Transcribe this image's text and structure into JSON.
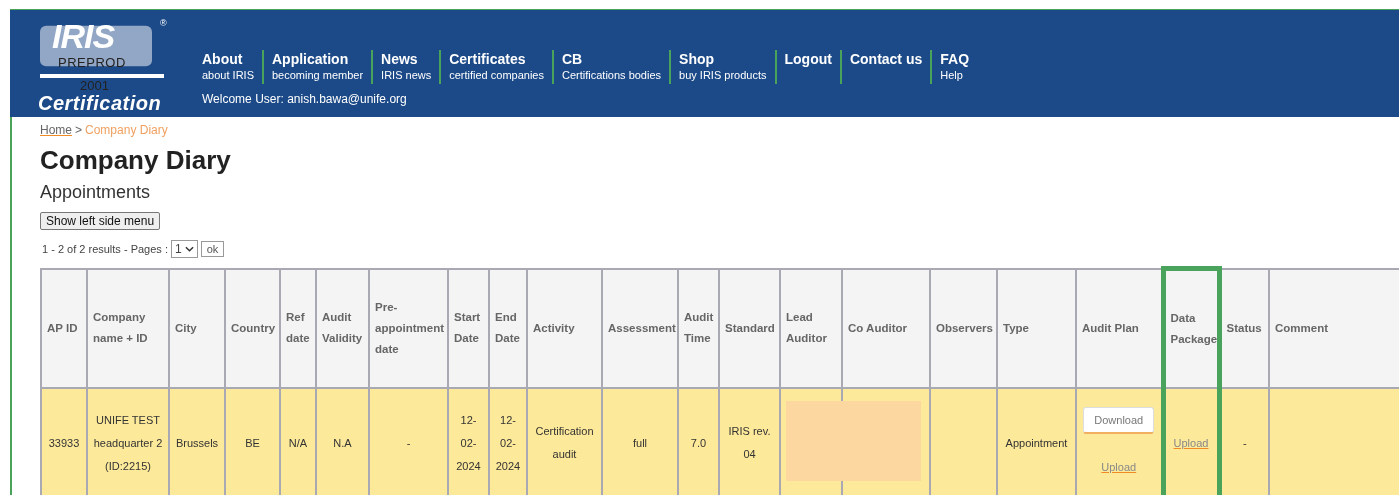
{
  "logo": {
    "wordmark": "IRIS",
    "registered": "®",
    "env_label": "PREPROD",
    "year": "2001",
    "tagline": "Certification"
  },
  "nav": [
    {
      "title": "About",
      "subtitle": "about IRIS"
    },
    {
      "title": "Application",
      "subtitle": "becoming member"
    },
    {
      "title": "News",
      "subtitle": "IRIS news"
    },
    {
      "title": "Certificates",
      "subtitle": "certified companies"
    },
    {
      "title": "CB",
      "subtitle": "Certifications bodies"
    },
    {
      "title": "Shop",
      "subtitle": "buy IRIS products"
    },
    {
      "title": "Logout"
    },
    {
      "title": "Contact us"
    },
    {
      "title": "FAQ",
      "subtitle": "Help"
    }
  ],
  "welcome": "Welcome User: anish.bawa@unife.org",
  "breadcrumb": {
    "home": "Home",
    "separator": ">",
    "current": "Company Diary"
  },
  "title": "Company Diary",
  "subtitle": "Appointments",
  "side_menu_button": "Show left side menu",
  "pagination": {
    "summary": "1 - 2 of 2 results - Pages :",
    "page": "1",
    "ok": "ok"
  },
  "table": {
    "columns": [
      {
        "label": "AP ID",
        "highlighted": false
      },
      {
        "label": "Company name + ID",
        "highlighted": false
      },
      {
        "label": "City",
        "highlighted": false
      },
      {
        "label": "Country",
        "highlighted": false
      },
      {
        "label": "Ref date",
        "highlighted": false
      },
      {
        "label": "Audit Validity",
        "highlighted": false
      },
      {
        "label": "Pre-appointment date",
        "highlighted": false
      },
      {
        "label": "Start Date",
        "highlighted": false
      },
      {
        "label": "End Date",
        "highlighted": false
      },
      {
        "label": "Activity",
        "highlighted": false
      },
      {
        "label": "Assessment",
        "highlighted": false
      },
      {
        "label": "Audit Time",
        "highlighted": false
      },
      {
        "label": "Standard",
        "highlighted": false
      },
      {
        "label": "Lead Auditor",
        "highlighted": false
      },
      {
        "label": "Co Auditor",
        "highlighted": false
      },
      {
        "label": "Observers",
        "highlighted": false
      },
      {
        "label": "Type",
        "highlighted": false
      },
      {
        "label": "Audit Plan",
        "highlighted": false
      },
      {
        "label": "Data Package",
        "highlighted": true
      },
      {
        "label": "Status",
        "highlighted": false
      },
      {
        "label": "Comment",
        "highlighted": false
      }
    ],
    "rows": [
      {
        "cells": [
          {
            "kind": "text",
            "text": "33933"
          },
          {
            "kind": "text",
            "text": "UNIFE TEST headquarter 2 (ID:2215)"
          },
          {
            "kind": "text",
            "text": "Brussels"
          },
          {
            "kind": "text",
            "text": "BE"
          },
          {
            "kind": "text",
            "text": "N/A"
          },
          {
            "kind": "text",
            "text": "N.A"
          },
          {
            "kind": "text",
            "text": "-"
          },
          {
            "kind": "text",
            "text": "12-02-2024"
          },
          {
            "kind": "text",
            "text": "12-02-2024"
          },
          {
            "kind": "text",
            "text": "Certification audit"
          },
          {
            "kind": "text",
            "text": "full"
          },
          {
            "kind": "text",
            "text": "7.0"
          },
          {
            "kind": "text",
            "text": "IRIS rev. 04"
          },
          {
            "kind": "redacted"
          },
          {
            "kind": "blank"
          },
          {
            "kind": "blank"
          },
          {
            "kind": "text",
            "text": "Appointment"
          },
          {
            "kind": "plan",
            "download": "Download",
            "upload": "Upload"
          },
          {
            "kind": "link",
            "text": "Upload"
          },
          {
            "kind": "text",
            "text": "-"
          },
          {
            "kind": "blank"
          }
        ]
      }
    ]
  }
}
